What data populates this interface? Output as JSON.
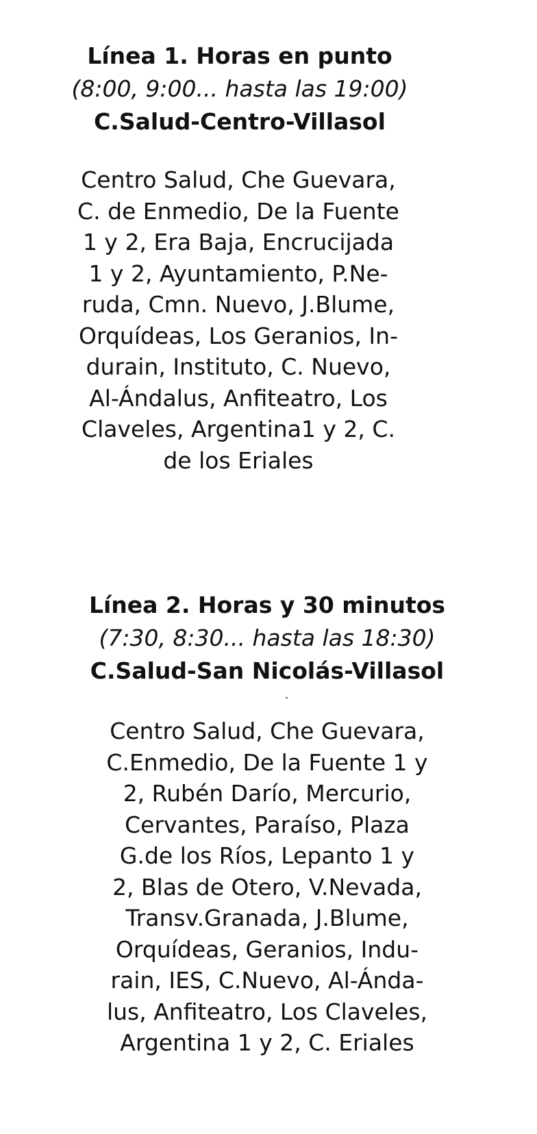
{
  "lines": [
    {
      "title": "Línea 1. Horas en punto",
      "hours": "(8:00, 9:00... hasta las 19:00)",
      "route": "C.Salud-Centro-Villasol",
      "stops_lines": [
        "Centro Salud, Che Guevara,",
        "C. de Enmedio, De la Fuente",
        "1 y 2, Era Baja, Encrucijada",
        "1 y 2, Ayuntamiento, P.Ne-",
        "ruda, Cmn. Nuevo, J.Blume,",
        "Orquídeas, Los Geranios, In-",
        "durain, Instituto, C. Nuevo,",
        "Al-Ándalus, Anfiteatro, Los",
        "Claveles, Argentina1 y 2, C.",
        "de los Eriales"
      ]
    },
    {
      "title": "Línea 2. Horas y 30 minutos",
      "hours": "(7:30, 8:30... hasta las 18:30)",
      "route": "C.Salud-San Nicolás-Villasol",
      "stops_lines": [
        "Centro Salud, Che Guevara,",
        "C.Enmedio, De la Fuente 1 y",
        "2, Rubén Darío, Mercurio,",
        "Cervantes, Paraíso, Plaza",
        "G.de los Ríos, Lepanto 1 y",
        "2, Blas de Otero, V.Nevada,",
        "Transv.Granada, J.Blume,",
        "Orquídeas, Geranios, Indu-",
        "rain, IES, C.Nuevo, Al-Ánda-",
        "lus, Anfiteatro, Los Claveles,",
        "Argentina 1 y 2, C. Eriales"
      ]
    }
  ]
}
